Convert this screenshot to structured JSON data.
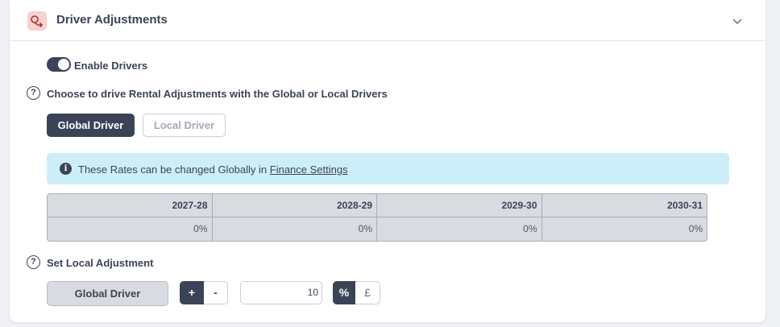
{
  "panel": {
    "title": "Driver Adjustments",
    "icon": "driver-adjustments-icon"
  },
  "toggle": {
    "label": "Enable Drivers",
    "enabled": true
  },
  "driver_choice": {
    "question": "Choose to drive Rental Adjustments with the Global or Local Drivers",
    "options": [
      "Global Driver",
      "Local Driver"
    ],
    "selected": "Global Driver"
  },
  "info": {
    "text": "These Rates can be changed Globally in ",
    "link": "Finance Settings"
  },
  "rates": {
    "headers": [
      "2027-28",
      "2028-29",
      "2029-30",
      "2030-31"
    ],
    "values": [
      "0%",
      "0%",
      "0%",
      "0%"
    ]
  },
  "local_adjustment": {
    "label": "Set Local Adjustment",
    "driver_label": "Global Driver",
    "plus": "+",
    "minus": "-",
    "value": "10",
    "percent": "%",
    "pound": "£"
  },
  "colors": {
    "primary": "#3b4457",
    "info_bg": "#cdeef8",
    "icon_bg": "#f6d2d2",
    "icon_fg": "#c0392b"
  }
}
